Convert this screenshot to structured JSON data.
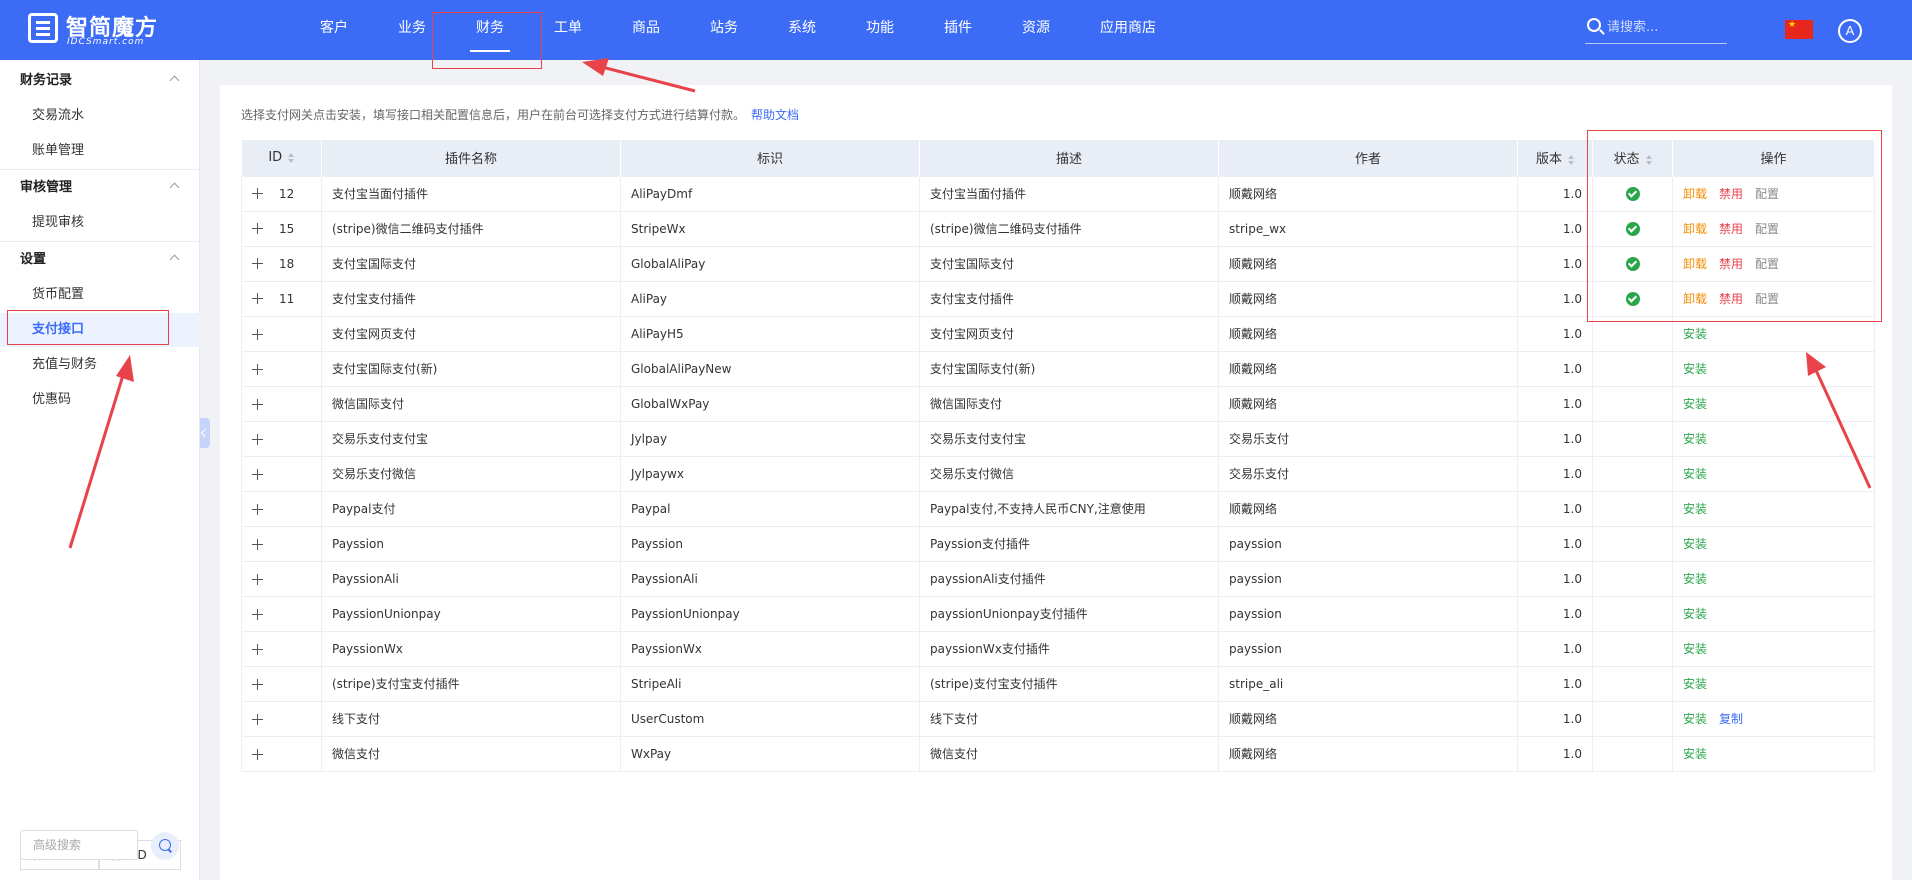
{
  "brand": {
    "name": "智简魔方",
    "sub": "IDCSmart.com"
  },
  "nav": [
    {
      "label": "客户"
    },
    {
      "label": "业务"
    },
    {
      "label": "财务",
      "active": true
    },
    {
      "label": "工单"
    },
    {
      "label": "商品"
    },
    {
      "label": "站务"
    },
    {
      "label": "系统"
    },
    {
      "label": "功能"
    },
    {
      "label": "插件"
    },
    {
      "label": "资源"
    },
    {
      "label": "应用商店"
    }
  ],
  "search": {
    "placeholder": "请搜索..."
  },
  "user": {
    "avatar": "A"
  },
  "sidebar": {
    "groups": [
      {
        "label": "财务记录",
        "items": [
          {
            "label": "交易流水"
          },
          {
            "label": "账单管理"
          }
        ]
      },
      {
        "label": "审核管理",
        "items": [
          {
            "label": "提现审核"
          }
        ]
      },
      {
        "label": "设置",
        "items": [
          {
            "label": "货币配置"
          },
          {
            "label": "支付接口",
            "active": true
          },
          {
            "label": "充值与财务"
          },
          {
            "label": "优惠码"
          }
        ]
      }
    ],
    "filter": {
      "type": "客户",
      "field": "客户ID",
      "placeholder": "高级搜索"
    }
  },
  "main": {
    "tip": "选择支付网关点击安装，填写接口相关配置信息后，用户在前台可选择支付方式进行结算付款。",
    "help_link": "帮助文档",
    "columns": [
      "ID",
      "插件名称",
      "标识",
      "描述",
      "作者",
      "版本",
      "状态",
      "操作"
    ],
    "actions": {
      "uninstall": "卸载",
      "disable": "禁用",
      "config": "配置",
      "install": "安装",
      "copy": "复制"
    },
    "rows": [
      {
        "id": "12",
        "name": "支付宝当面付插件",
        "key": "AliPayDmf",
        "desc": "支付宝当面付插件",
        "author": "顺戴网络",
        "version": "1.0",
        "installed": true
      },
      {
        "id": "15",
        "name": "(stripe)微信二维码支付插件",
        "key": "StripeWx",
        "desc": "(stripe)微信二维码支付插件",
        "author": "stripe_wx",
        "version": "1.0",
        "installed": true
      },
      {
        "id": "18",
        "name": "支付宝国际支付",
        "key": "GlobalAliPay",
        "desc": "支付宝国际支付",
        "author": "顺戴网络",
        "version": "1.0",
        "installed": true
      },
      {
        "id": "11",
        "name": "支付宝支付插件",
        "key": "AliPay",
        "desc": "支付宝支付插件",
        "author": "顺戴网络",
        "version": "1.0",
        "installed": true
      },
      {
        "id": "",
        "name": "支付宝网页支付",
        "key": "AliPayH5",
        "desc": "支付宝网页支付",
        "author": "顺戴网络",
        "version": "1.0",
        "installed": false
      },
      {
        "id": "",
        "name": "支付宝国际支付(新)",
        "key": "GlobalAliPayNew",
        "desc": "支付宝国际支付(新)",
        "author": "顺戴网络",
        "version": "1.0",
        "installed": false
      },
      {
        "id": "",
        "name": "微信国际支付",
        "key": "GlobalWxPay",
        "desc": "微信国际支付",
        "author": "顺戴网络",
        "version": "1.0",
        "installed": false
      },
      {
        "id": "",
        "name": "交易乐支付支付宝",
        "key": "Jylpay",
        "desc": "交易乐支付支付宝",
        "author": "交易乐支付",
        "version": "1.0",
        "installed": false
      },
      {
        "id": "",
        "name": "交易乐支付微信",
        "key": "Jylpaywx",
        "desc": "交易乐支付微信",
        "author": "交易乐支付",
        "version": "1.0",
        "installed": false
      },
      {
        "id": "",
        "name": "Paypal支付",
        "key": "Paypal",
        "desc": "Paypal支付,不支持人民币CNY,注意使用",
        "author": "顺戴网络",
        "version": "1.0",
        "installed": false
      },
      {
        "id": "",
        "name": "Payssion",
        "key": "Payssion",
        "desc": "Payssion支付插件",
        "author": "payssion",
        "version": "1.0",
        "installed": false
      },
      {
        "id": "",
        "name": "PayssionAli",
        "key": "PayssionAli",
        "desc": "payssionAli支付插件",
        "author": "payssion",
        "version": "1.0",
        "installed": false
      },
      {
        "id": "",
        "name": "PayssionUnionpay",
        "key": "PayssionUnionpay",
        "desc": "payssionUnionpay支付插件",
        "author": "payssion",
        "version": "1.0",
        "installed": false
      },
      {
        "id": "",
        "name": "PayssionWx",
        "key": "PayssionWx",
        "desc": "payssionWx支付插件",
        "author": "payssion",
        "version": "1.0",
        "installed": false
      },
      {
        "id": "",
        "name": "(stripe)支付宝支付插件",
        "key": "StripeAli",
        "desc": "(stripe)支付宝支付插件",
        "author": "stripe_ali",
        "version": "1.0",
        "installed": false
      },
      {
        "id": "",
        "name": "线下支付",
        "key": "UserCustom",
        "desc": "线下支付",
        "author": "顺戴网络",
        "version": "1.0",
        "installed": false,
        "copyable": true
      },
      {
        "id": "",
        "name": "微信支付",
        "key": "WxPay",
        "desc": "微信支付",
        "author": "顺戴网络",
        "version": "1.0",
        "installed": false
      }
    ]
  },
  "colors": {
    "primary": "#3c6cf6",
    "annotation": "#e8424a",
    "success": "#2ba64b",
    "warning": "#f08c00"
  }
}
